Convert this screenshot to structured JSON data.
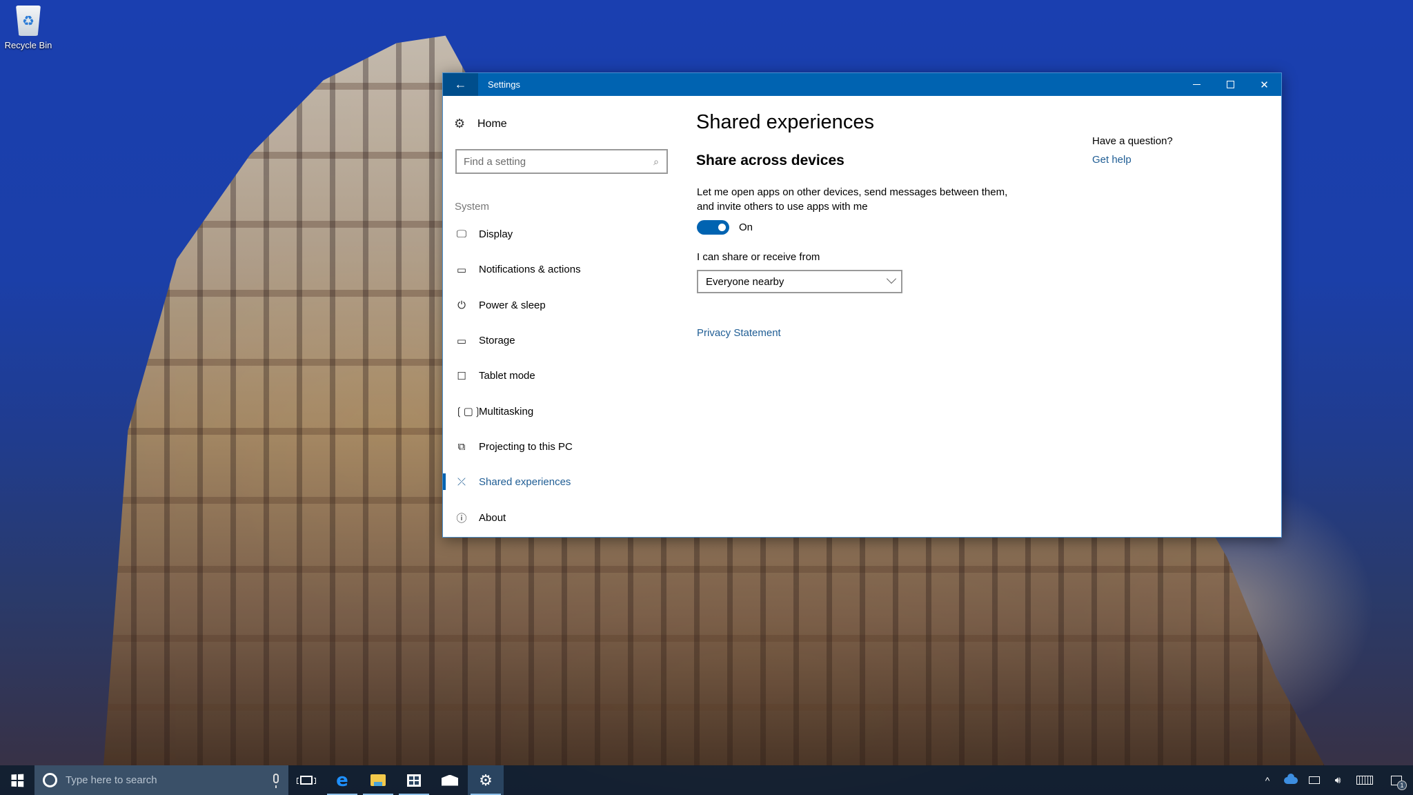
{
  "desktop": {
    "icons": [
      {
        "label": "Recycle Bin",
        "icon": "recycle-bin-icon"
      }
    ]
  },
  "window": {
    "title": "Settings",
    "back_icon": "arrow-left-icon",
    "controls": {
      "minimize": "minimize-icon",
      "maximize": "maximize-icon",
      "close": "close-icon",
      "close_glyph": "✕"
    }
  },
  "nav": {
    "home": {
      "label": "Home",
      "icon": "gear-icon",
      "glyph": "⚙"
    },
    "search": {
      "placeholder": "Find a setting",
      "value": "",
      "icon": "search-icon",
      "glyph": "⌕"
    },
    "section_label": "System",
    "items": [
      {
        "label": "Display",
        "icon": "monitor-icon",
        "glyph": "🖵",
        "active": false
      },
      {
        "label": "Notifications & actions",
        "icon": "notification-icon",
        "glyph": "▭",
        "active": false
      },
      {
        "label": "Power & sleep",
        "icon": "power-icon",
        "glyph": "⏻",
        "active": false
      },
      {
        "label": "Storage",
        "icon": "storage-icon",
        "glyph": "▭",
        "active": false
      },
      {
        "label": "Tablet mode",
        "icon": "tablet-mode-icon",
        "glyph": "☐",
        "active": false
      },
      {
        "label": "Multitasking",
        "icon": "multitasking-icon",
        "glyph": "❲▢❳",
        "active": false
      },
      {
        "label": "Projecting to this PC",
        "icon": "projecting-icon",
        "glyph": "⧉",
        "active": false
      },
      {
        "label": "Shared experiences",
        "icon": "shared-experiences-icon",
        "glyph": "⤫",
        "active": true
      },
      {
        "label": "About",
        "icon": "info-icon",
        "glyph": "ⓘ",
        "active": false
      }
    ]
  },
  "content": {
    "title": "Shared experiences",
    "section_title": "Share across devices",
    "description": "Let me open apps on other devices, send messages between them, and invite others to use apps with me",
    "toggle": {
      "state": "On",
      "on": true,
      "accent": "#0063b1"
    },
    "dropdown": {
      "label": "I can share or receive from",
      "selected": "Everyone nearby",
      "icon": "chevron-down-icon"
    },
    "privacy_link": "Privacy Statement",
    "help": {
      "question": "Have a question?",
      "link": "Get help"
    }
  },
  "taskbar": {
    "start_icon": "windows-logo-icon",
    "search_placeholder": "Type here to search",
    "cortana_icon": "cortana-icon",
    "mic_icon": "microphone-icon",
    "apps": [
      {
        "name": "Task View",
        "icon": "task-view-icon",
        "running": false,
        "active": false
      },
      {
        "name": "Microsoft Edge",
        "icon": "edge-icon",
        "glyph": "e",
        "running": true,
        "active": false
      },
      {
        "name": "File Explorer",
        "icon": "file-explorer-icon",
        "running": true,
        "active": false
      },
      {
        "name": "Store",
        "icon": "store-icon",
        "running": true,
        "active": false
      },
      {
        "name": "Mail",
        "icon": "mail-icon",
        "running": false,
        "active": false
      },
      {
        "name": "Settings",
        "icon": "settings-gear-icon",
        "glyph": "⚙",
        "running": true,
        "active": true
      }
    ],
    "tray": {
      "chevron_glyph": "^",
      "notification_count": "1"
    }
  },
  "colors": {
    "titlebar": "#0063b1",
    "back_button": "#004e8c",
    "link": "#1f5d94",
    "accent": "#0063b1"
  }
}
